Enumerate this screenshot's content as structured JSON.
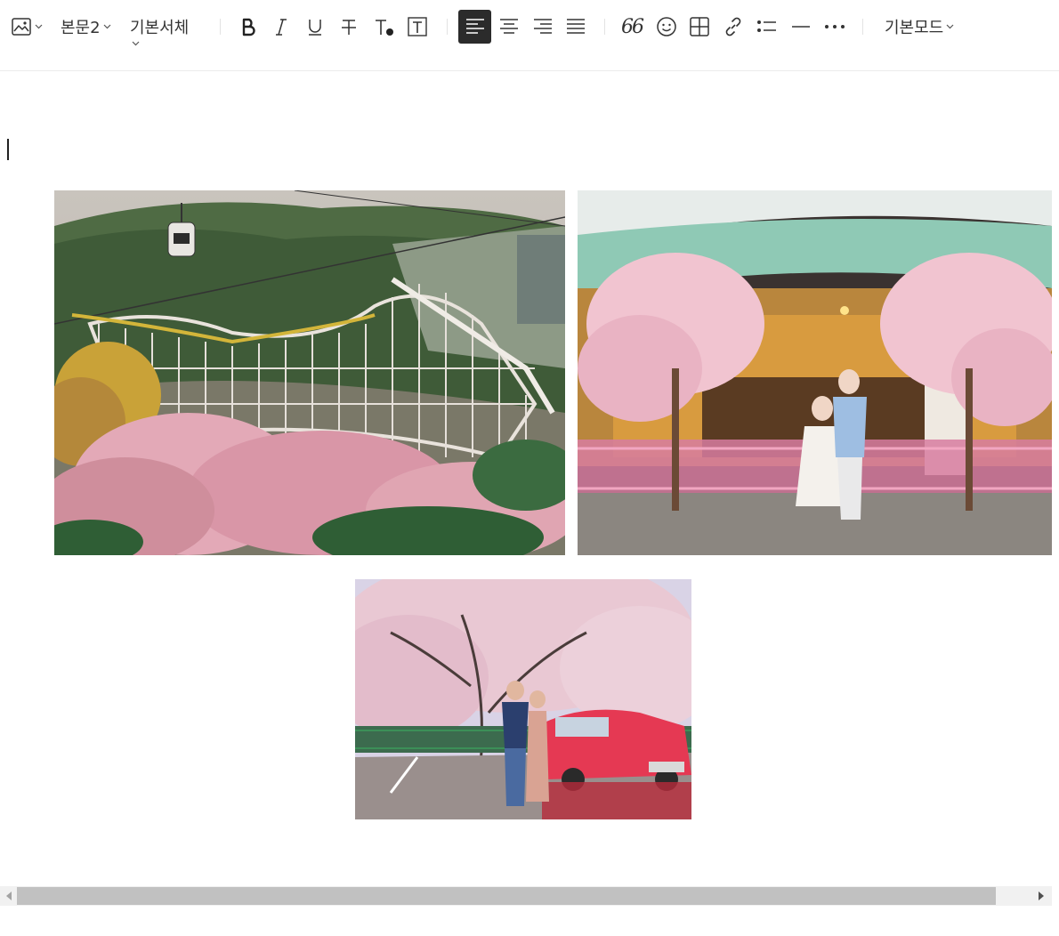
{
  "toolbar": {
    "paragraph_style": "본문2",
    "font_family": "기본서체",
    "mode": "기본모드",
    "quote_label": "66"
  },
  "icons": {
    "image": "image-icon",
    "bold": "bold-icon",
    "italic": "italic-icon",
    "underline": "underline-icon",
    "strikethrough": "strikethrough-icon",
    "text_color": "text-color-icon",
    "text_background": "text-background-icon",
    "align_left": "align-left-icon",
    "align_center": "align-center-icon",
    "align_right": "align-right-icon",
    "align_justify": "align-justify-icon",
    "quote": "quote-icon",
    "emoji": "emoji-icon",
    "table": "table-icon",
    "link": "link-icon",
    "list": "list-icon",
    "horizontal_rule": "horizontal-rule-icon",
    "more": "more-icon"
  },
  "colors": {
    "active_align_bg": "#2b2b2b",
    "divider": "#ececec"
  },
  "editor": {
    "photos": [
      "amusement-park-photo",
      "carousel-photo",
      "couple-car-photo"
    ]
  }
}
